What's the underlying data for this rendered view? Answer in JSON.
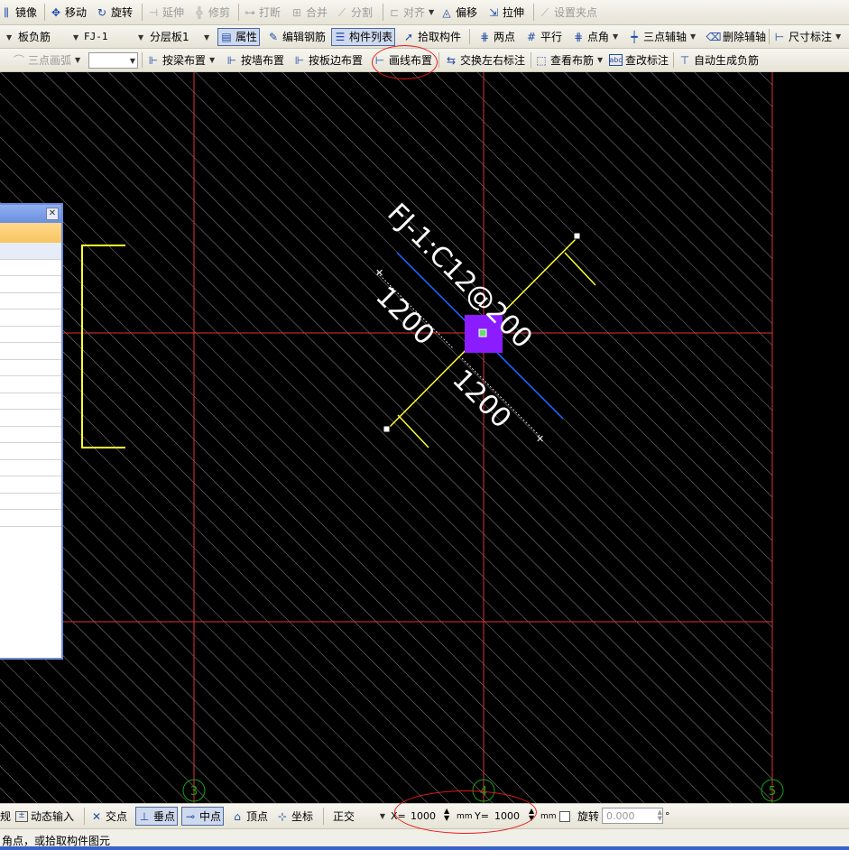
{
  "toolbar1": {
    "mirror": "镜像",
    "move": "移动",
    "rotate": "旋转",
    "extend": "延伸",
    "trim": "修剪",
    "break": "打断",
    "merge": "合并",
    "split": "分割",
    "align": "对齐",
    "offset": "偏移",
    "stretch": "拉伸",
    "set_grip": "设置夹点"
  },
  "toolbar2": {
    "type_select": "板负筋",
    "component_select": "FJ-1",
    "layer_select": "分层板1",
    "properties": "属性",
    "edit_rebar": "编辑钢筋",
    "component_list": "构件列表",
    "pick_component": "拾取构件",
    "two_point": "两点",
    "parallel": "平行",
    "point_angle": "点角",
    "three_point_aux": "三点辅轴",
    "delete_aux": "删除辅轴",
    "dimension": "尺寸标注"
  },
  "toolbar3": {
    "three_point_arc": "三点画弧",
    "by_beam": "按梁布置",
    "by_wall": "按墙布置",
    "by_slab_edge": "按板边布置",
    "draw_line": "画线布置",
    "swap_labels": "交换左右标注",
    "view_layout": "查看布筋",
    "edit_label": "查改标注",
    "auto_generate": "自动生成负筋"
  },
  "drawing": {
    "rebar_label": "FJ-1:C12@200",
    "dim_left": "1200",
    "dim_right": "1200",
    "axis_3": "3",
    "axis_4": "4",
    "axis_5": "5"
  },
  "statusbar": {
    "view_partial": "规",
    "dynamic_input": "动态输入",
    "intersection": "交点",
    "perpendicular": "垂点",
    "midpoint": "中点",
    "vertex": "顶点",
    "coordinate": "坐标",
    "ortho": "正交",
    "x_label": "X=",
    "x_value": "1000",
    "x_unit": "mm",
    "y_label": "Y=",
    "y_value": "1000",
    "y_unit": "mm",
    "rotate_label": "旋转",
    "rotate_value": "0.000",
    "degree": "°"
  },
  "prompt": {
    "text": "角点，或拾取构件图元"
  },
  "colors": {
    "grid": "#e03232",
    "rebar": "#ffff33",
    "axis": "#1f5fff",
    "selected": "#8a1cff",
    "hatch": "#8a8a8a",
    "highlight": "#e81818"
  }
}
